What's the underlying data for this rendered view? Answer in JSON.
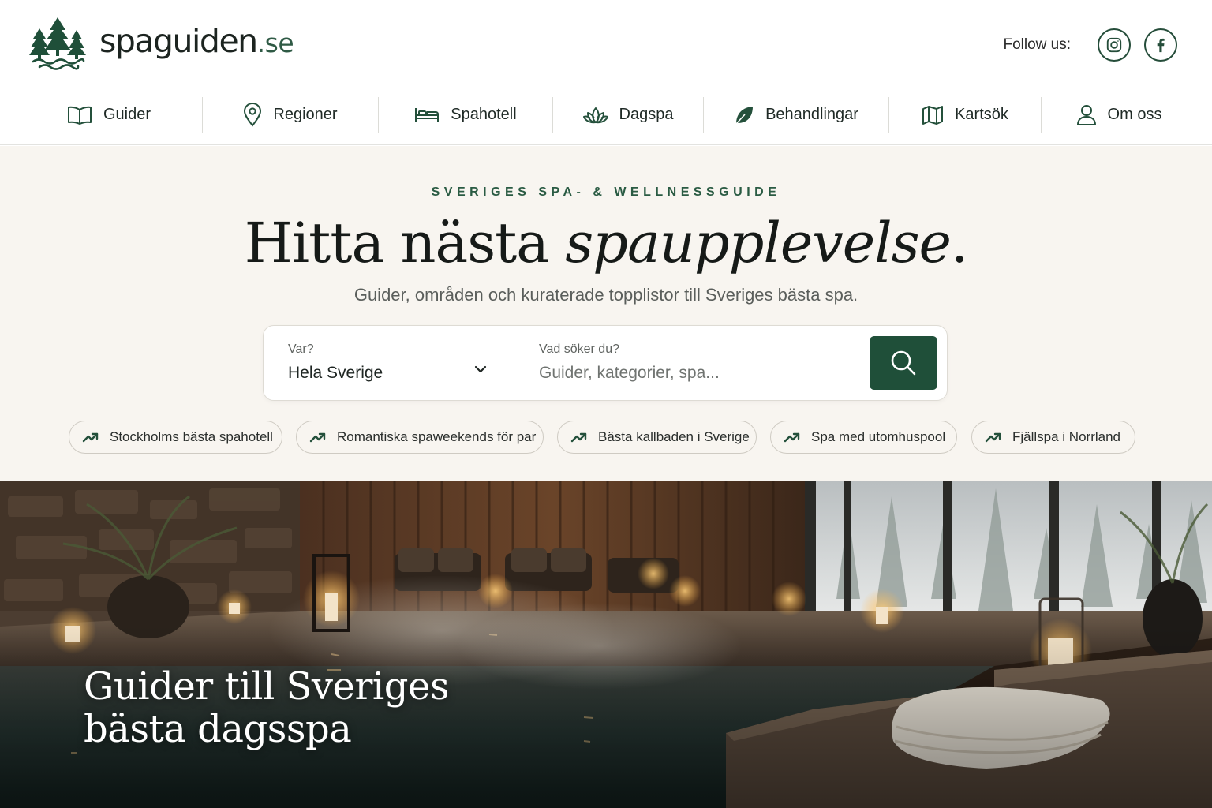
{
  "brand": {
    "name": "spaguiden",
    "tld": ".se",
    "accent_color": "#1f4f39"
  },
  "header": {
    "follow_label": "Follow us:",
    "social": [
      {
        "icon": "instagram-icon"
      },
      {
        "icon": "facebook-icon"
      }
    ]
  },
  "nav": {
    "items": [
      {
        "label": "Guider",
        "icon": "book-icon"
      },
      {
        "label": "Regioner",
        "icon": "map-pin-icon"
      },
      {
        "label": "Spahotell",
        "icon": "bed-icon"
      },
      {
        "label": "Dagspa",
        "icon": "lotus-icon"
      },
      {
        "label": "Behandlingar",
        "icon": "leaf-icon"
      },
      {
        "label": "Kartsök",
        "icon": "map-icon"
      },
      {
        "label": "Om oss",
        "icon": "user-icon"
      }
    ]
  },
  "hero": {
    "eyebrow": "SVERIGES SPA- & WELLNESSGUIDE",
    "headline_plain": "Hitta nästa ",
    "headline_italic": "spaupplevelse",
    "headline_end": ".",
    "subline": "Guider, områden och kuraterade topplistor till Sveriges bästa spa."
  },
  "search": {
    "where_label": "Var?",
    "where_value": "Hela Sverige",
    "what_label": "Vad söker du?",
    "what_placeholder": "Guider, kategorier, spa..."
  },
  "chips": [
    {
      "label": "Stockholms bästa spahotell"
    },
    {
      "label": "Romantiska spaweekends för par"
    },
    {
      "label": "Bästa kallbaden i Sverige"
    },
    {
      "label": "Spa med utomhuspool"
    },
    {
      "label": "Fjällspa i Norrland"
    }
  ],
  "feature": {
    "title_line1": "Guider till Sveriges",
    "title_line2": "bästa dagsspa"
  }
}
